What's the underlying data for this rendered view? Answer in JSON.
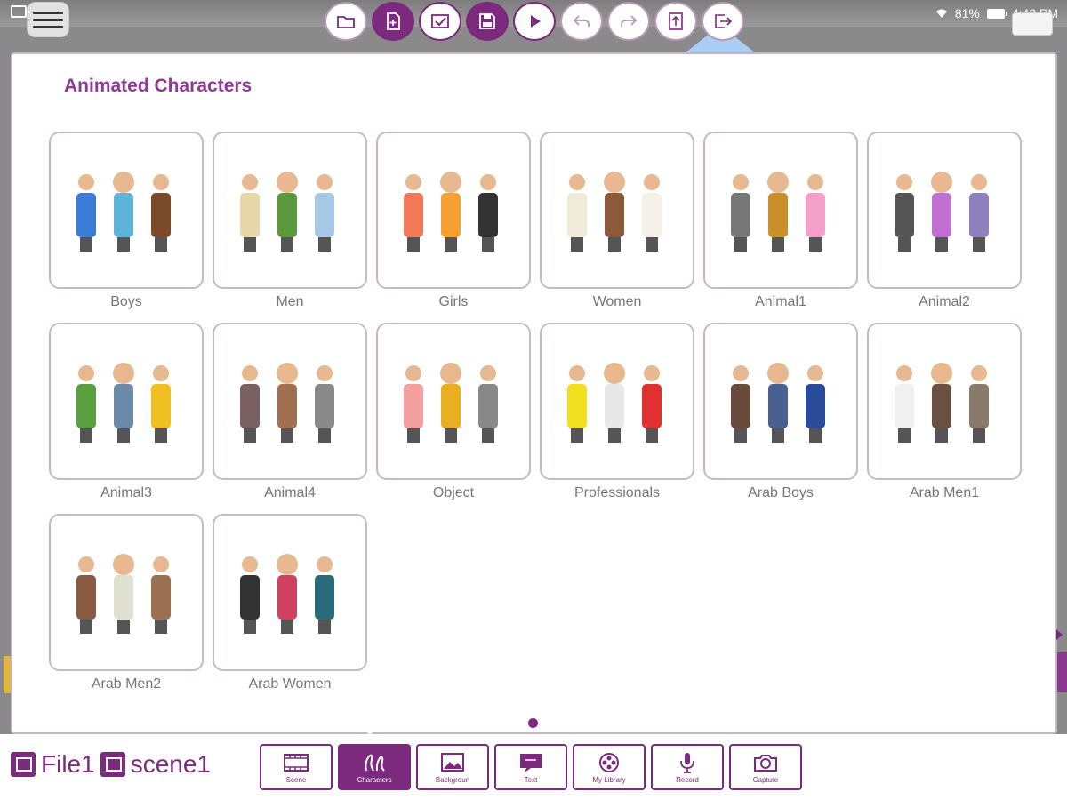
{
  "status_bar": {
    "battery": "81%",
    "time": "4:43 PM"
  },
  "toolbar": [
    {
      "name": "open-folder",
      "active": false
    },
    {
      "name": "new-file",
      "active": true
    },
    {
      "name": "check",
      "active": false
    },
    {
      "name": "save",
      "active": true
    },
    {
      "name": "play",
      "active": false
    },
    {
      "name": "undo",
      "active": false
    },
    {
      "name": "redo",
      "active": false
    },
    {
      "name": "upload",
      "active": false
    },
    {
      "name": "export",
      "active": false
    }
  ],
  "panel": {
    "title": "Animated Characters",
    "categories": [
      "Boys",
      "Men",
      "Girls",
      "Women",
      "Animal1",
      "Animal2",
      "Animal3",
      "Animal4",
      "Object",
      "Professionals",
      "Arab Boys",
      "Arab Men1",
      "Arab Men2",
      "Arab Women"
    ]
  },
  "bottom": {
    "file_name": "File1",
    "scene_name": "scene1",
    "tabs": [
      {
        "label": "Scene",
        "icon": "film-icon",
        "active": false
      },
      {
        "label": "Characters",
        "icon": "characters-icon",
        "active": true
      },
      {
        "label": "Backgroun",
        "icon": "image-icon",
        "active": false
      },
      {
        "label": "Text",
        "icon": "text-icon",
        "active": false
      },
      {
        "label": "My Library",
        "icon": "reel-icon",
        "active": false
      },
      {
        "label": "Record",
        "icon": "microphone-icon",
        "active": false
      },
      {
        "label": "Capture",
        "icon": "camera-icon",
        "active": false
      }
    ]
  },
  "colors": {
    "accent": "#7b2a7e",
    "title": "#8e3a96"
  }
}
